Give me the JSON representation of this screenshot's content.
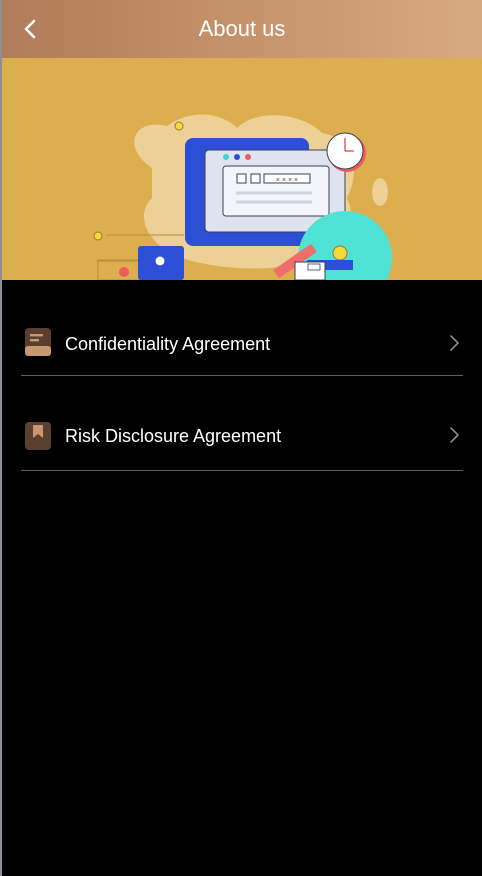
{
  "header": {
    "title": "About us",
    "back_icon": "chevron-left-icon"
  },
  "banner": {
    "illustration": "workspace-illustration",
    "window_text": "× × × ×"
  },
  "items": [
    {
      "label": "Confidentiality Agreement",
      "icon": "document-icon",
      "chevron": "chevron-right-icon"
    },
    {
      "label": "Risk Disclosure Agreement",
      "icon": "bookmark-icon",
      "chevron": "chevron-right-icon"
    }
  ],
  "colors": {
    "header_start": "#b07c59",
    "header_end": "#d8aa82",
    "banner_bg": "#dcae4e",
    "background": "#000000",
    "divider": "#5e5e5e",
    "icon_dark": "#5a3e2e",
    "icon_light": "#c79873"
  }
}
